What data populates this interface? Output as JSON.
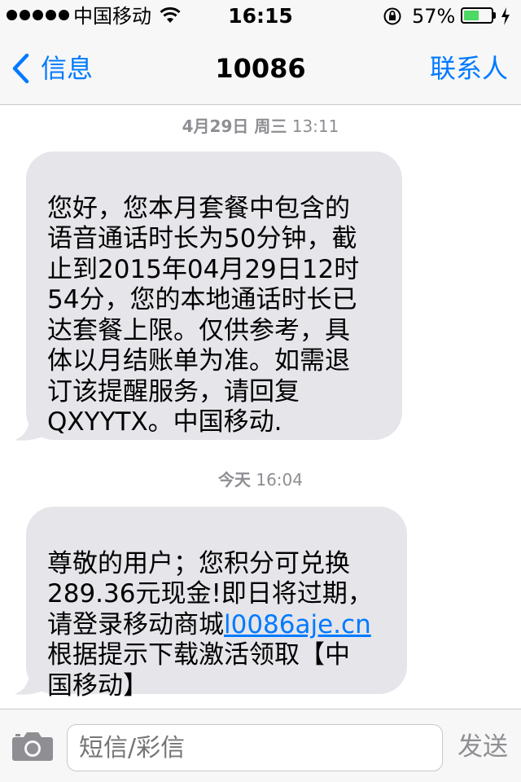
{
  "status_bar": {
    "carrier": "中国移动",
    "time": "16:15",
    "battery_percent_label": "57%",
    "battery_level": 0.57
  },
  "nav": {
    "back_label": "信息",
    "title": "10086",
    "contact_label": "联系人"
  },
  "messages": [
    {
      "timestamp_date": "4月29日 周三",
      "timestamp_time": "13:11",
      "text": "您好，您本月套餐中包含的\n语音通话时长为50分钟，截\n止到2015年04月29日12时\n54分，您的本地通话时长已\n达套餐上限。仅供参考，具\n体以月结账单为准。如需退\n订该提醒服务，请回复\nQXYYTX。中国移动."
    },
    {
      "timestamp_date": "今天",
      "timestamp_time": "16:04",
      "text_before_link": "尊敬的用户；您积分可兑换\n289.36元现金!即日将过期，\n请登录移动商城",
      "link": "l0086aje.cn",
      "text_after_link": "\n根据提示下载激活领取【中\n国移动】"
    }
  ],
  "input": {
    "placeholder": "短信/彩信",
    "send_label": "发送"
  },
  "colors": {
    "accent": "#007aff",
    "bubble_incoming": "#e5e5ea",
    "battery_fill": "#4cd964"
  }
}
